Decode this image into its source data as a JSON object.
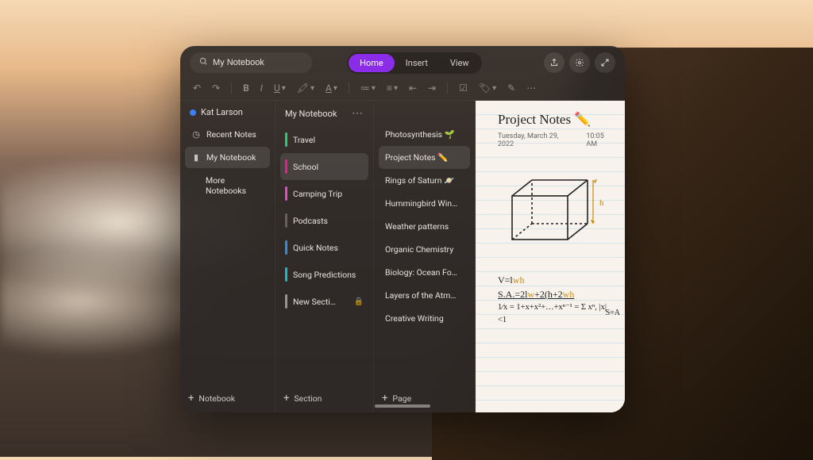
{
  "header": {
    "search_value": "My Notebook",
    "tabs": [
      {
        "label": "Home",
        "active": true
      },
      {
        "label": "Insert",
        "active": false
      },
      {
        "label": "View",
        "active": false
      }
    ]
  },
  "user": {
    "name": "Kat Larson"
  },
  "sidebar": {
    "items": [
      {
        "icon": "clock",
        "label": "Recent Notes",
        "selected": false
      },
      {
        "icon": "notebook",
        "label": "My Notebook",
        "selected": true
      },
      {
        "icon": "none",
        "label": "More Notebooks",
        "selected": false
      }
    ],
    "footer": "Notebook"
  },
  "notebook": {
    "title": "My Notebook",
    "sections": [
      {
        "color": "#2ecc71",
        "label": "Travel",
        "selected": false,
        "locked": false
      },
      {
        "color": "#e91e8f",
        "label": "School",
        "selected": true,
        "locked": false
      },
      {
        "color": "#e04ec4",
        "label": "Camping Trip",
        "selected": false,
        "locked": false
      },
      {
        "color": "#6b5e55",
        "label": "Podcasts",
        "selected": false,
        "locked": false
      },
      {
        "color": "#2e8fe0",
        "label": "Quick Notes",
        "selected": false,
        "locked": false
      },
      {
        "color": "#1fb8c9",
        "label": "Song Predictions",
        "selected": false,
        "locked": false
      },
      {
        "color": "#9a938c",
        "label": "New Secti…",
        "selected": false,
        "locked": true
      }
    ],
    "footer": "Section"
  },
  "pages": {
    "items": [
      {
        "label": "Photosynthesis 🌱",
        "selected": false
      },
      {
        "label": "Project Notes ✏️",
        "selected": true
      },
      {
        "label": "Rings of Saturn 🪐",
        "selected": false
      },
      {
        "label": "Hummingbird Win…",
        "selected": false
      },
      {
        "label": "Weather patterns",
        "selected": false
      },
      {
        "label": "Organic Chemistry",
        "selected": false
      },
      {
        "label": "Biology: Ocean Fo…",
        "selected": false
      },
      {
        "label": "Layers of the Atm…",
        "selected": false
      },
      {
        "label": "Creative Writing",
        "selected": false
      }
    ],
    "footer": "Page"
  },
  "note": {
    "title": "Project Notes ✏️",
    "date": "Tuesday, March 29, 2022",
    "time": "10:05 AM",
    "formulas": {
      "line1_prefix": "V=l",
      "line1_hl": "wh",
      "line2_prefix": "S.A.=2l",
      "line2_mid": "w",
      "line2_after": "+2(h+2",
      "line2_end": "wh",
      "line3": "1⁄x = 1+x+x²+…+xⁿ⁻¹ = Σ xⁿ, |x|<1",
      "side": "S=A"
    },
    "cube_labels": {
      "height": "h"
    }
  }
}
